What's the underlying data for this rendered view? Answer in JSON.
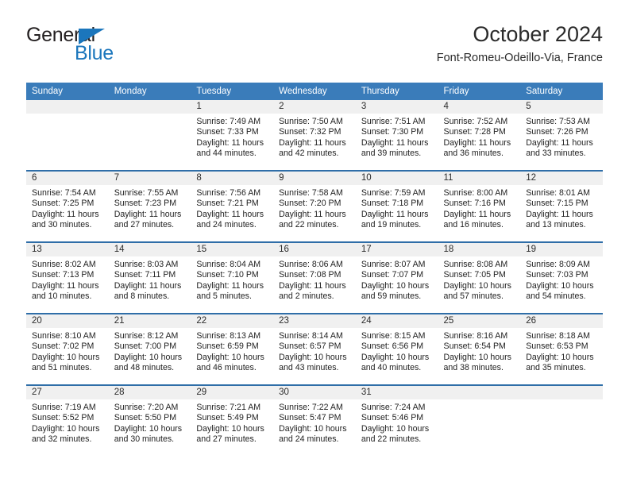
{
  "brand": {
    "name_part1": "General",
    "name_part2": "Blue",
    "triangle_icon": "triangle-icon",
    "colors": {
      "dark": "#231f20",
      "blue": "#1b76bc"
    }
  },
  "header": {
    "title": "October 2024",
    "subtitle": "Font-Romeu-Odeillo-Via, France"
  },
  "theme": {
    "header_bg": "#3a7cba",
    "row_divider": "#2f6ea8",
    "daynum_bg": "#f0f0f0",
    "text": "#222222"
  },
  "calendar": {
    "weekday_headers": [
      "Sunday",
      "Monday",
      "Tuesday",
      "Wednesday",
      "Thursday",
      "Friday",
      "Saturday"
    ],
    "weeks": [
      [
        {
          "day": "",
          "empty": true
        },
        {
          "day": "",
          "empty": true
        },
        {
          "day": "1",
          "sunrise": "Sunrise: 7:49 AM",
          "sunset": "Sunset: 7:33 PM",
          "daylight_l1": "Daylight: 11 hours",
          "daylight_l2": "and 44 minutes."
        },
        {
          "day": "2",
          "sunrise": "Sunrise: 7:50 AM",
          "sunset": "Sunset: 7:32 PM",
          "daylight_l1": "Daylight: 11 hours",
          "daylight_l2": "and 42 minutes."
        },
        {
          "day": "3",
          "sunrise": "Sunrise: 7:51 AM",
          "sunset": "Sunset: 7:30 PM",
          "daylight_l1": "Daylight: 11 hours",
          "daylight_l2": "and 39 minutes."
        },
        {
          "day": "4",
          "sunrise": "Sunrise: 7:52 AM",
          "sunset": "Sunset: 7:28 PM",
          "daylight_l1": "Daylight: 11 hours",
          "daylight_l2": "and 36 minutes."
        },
        {
          "day": "5",
          "sunrise": "Sunrise: 7:53 AM",
          "sunset": "Sunset: 7:26 PM",
          "daylight_l1": "Daylight: 11 hours",
          "daylight_l2": "and 33 minutes."
        }
      ],
      [
        {
          "day": "6",
          "sunrise": "Sunrise: 7:54 AM",
          "sunset": "Sunset: 7:25 PM",
          "daylight_l1": "Daylight: 11 hours",
          "daylight_l2": "and 30 minutes."
        },
        {
          "day": "7",
          "sunrise": "Sunrise: 7:55 AM",
          "sunset": "Sunset: 7:23 PM",
          "daylight_l1": "Daylight: 11 hours",
          "daylight_l2": "and 27 minutes."
        },
        {
          "day": "8",
          "sunrise": "Sunrise: 7:56 AM",
          "sunset": "Sunset: 7:21 PM",
          "daylight_l1": "Daylight: 11 hours",
          "daylight_l2": "and 24 minutes."
        },
        {
          "day": "9",
          "sunrise": "Sunrise: 7:58 AM",
          "sunset": "Sunset: 7:20 PM",
          "daylight_l1": "Daylight: 11 hours",
          "daylight_l2": "and 22 minutes."
        },
        {
          "day": "10",
          "sunrise": "Sunrise: 7:59 AM",
          "sunset": "Sunset: 7:18 PM",
          "daylight_l1": "Daylight: 11 hours",
          "daylight_l2": "and 19 minutes."
        },
        {
          "day": "11",
          "sunrise": "Sunrise: 8:00 AM",
          "sunset": "Sunset: 7:16 PM",
          "daylight_l1": "Daylight: 11 hours",
          "daylight_l2": "and 16 minutes."
        },
        {
          "day": "12",
          "sunrise": "Sunrise: 8:01 AM",
          "sunset": "Sunset: 7:15 PM",
          "daylight_l1": "Daylight: 11 hours",
          "daylight_l2": "and 13 minutes."
        }
      ],
      [
        {
          "day": "13",
          "sunrise": "Sunrise: 8:02 AM",
          "sunset": "Sunset: 7:13 PM",
          "daylight_l1": "Daylight: 11 hours",
          "daylight_l2": "and 10 minutes."
        },
        {
          "day": "14",
          "sunrise": "Sunrise: 8:03 AM",
          "sunset": "Sunset: 7:11 PM",
          "daylight_l1": "Daylight: 11 hours",
          "daylight_l2": "and 8 minutes."
        },
        {
          "day": "15",
          "sunrise": "Sunrise: 8:04 AM",
          "sunset": "Sunset: 7:10 PM",
          "daylight_l1": "Daylight: 11 hours",
          "daylight_l2": "and 5 minutes."
        },
        {
          "day": "16",
          "sunrise": "Sunrise: 8:06 AM",
          "sunset": "Sunset: 7:08 PM",
          "daylight_l1": "Daylight: 11 hours",
          "daylight_l2": "and 2 minutes."
        },
        {
          "day": "17",
          "sunrise": "Sunrise: 8:07 AM",
          "sunset": "Sunset: 7:07 PM",
          "daylight_l1": "Daylight: 10 hours",
          "daylight_l2": "and 59 minutes."
        },
        {
          "day": "18",
          "sunrise": "Sunrise: 8:08 AM",
          "sunset": "Sunset: 7:05 PM",
          "daylight_l1": "Daylight: 10 hours",
          "daylight_l2": "and 57 minutes."
        },
        {
          "day": "19",
          "sunrise": "Sunrise: 8:09 AM",
          "sunset": "Sunset: 7:03 PM",
          "daylight_l1": "Daylight: 10 hours",
          "daylight_l2": "and 54 minutes."
        }
      ],
      [
        {
          "day": "20",
          "sunrise": "Sunrise: 8:10 AM",
          "sunset": "Sunset: 7:02 PM",
          "daylight_l1": "Daylight: 10 hours",
          "daylight_l2": "and 51 minutes."
        },
        {
          "day": "21",
          "sunrise": "Sunrise: 8:12 AM",
          "sunset": "Sunset: 7:00 PM",
          "daylight_l1": "Daylight: 10 hours",
          "daylight_l2": "and 48 minutes."
        },
        {
          "day": "22",
          "sunrise": "Sunrise: 8:13 AM",
          "sunset": "Sunset: 6:59 PM",
          "daylight_l1": "Daylight: 10 hours",
          "daylight_l2": "and 46 minutes."
        },
        {
          "day": "23",
          "sunrise": "Sunrise: 8:14 AM",
          "sunset": "Sunset: 6:57 PM",
          "daylight_l1": "Daylight: 10 hours",
          "daylight_l2": "and 43 minutes."
        },
        {
          "day": "24",
          "sunrise": "Sunrise: 8:15 AM",
          "sunset": "Sunset: 6:56 PM",
          "daylight_l1": "Daylight: 10 hours",
          "daylight_l2": "and 40 minutes."
        },
        {
          "day": "25",
          "sunrise": "Sunrise: 8:16 AM",
          "sunset": "Sunset: 6:54 PM",
          "daylight_l1": "Daylight: 10 hours",
          "daylight_l2": "and 38 minutes."
        },
        {
          "day": "26",
          "sunrise": "Sunrise: 8:18 AM",
          "sunset": "Sunset: 6:53 PM",
          "daylight_l1": "Daylight: 10 hours",
          "daylight_l2": "and 35 minutes."
        }
      ],
      [
        {
          "day": "27",
          "sunrise": "Sunrise: 7:19 AM",
          "sunset": "Sunset: 5:52 PM",
          "daylight_l1": "Daylight: 10 hours",
          "daylight_l2": "and 32 minutes."
        },
        {
          "day": "28",
          "sunrise": "Sunrise: 7:20 AM",
          "sunset": "Sunset: 5:50 PM",
          "daylight_l1": "Daylight: 10 hours",
          "daylight_l2": "and 30 minutes."
        },
        {
          "day": "29",
          "sunrise": "Sunrise: 7:21 AM",
          "sunset": "Sunset: 5:49 PM",
          "daylight_l1": "Daylight: 10 hours",
          "daylight_l2": "and 27 minutes."
        },
        {
          "day": "30",
          "sunrise": "Sunrise: 7:22 AM",
          "sunset": "Sunset: 5:47 PM",
          "daylight_l1": "Daylight: 10 hours",
          "daylight_l2": "and 24 minutes."
        },
        {
          "day": "31",
          "sunrise": "Sunrise: 7:24 AM",
          "sunset": "Sunset: 5:46 PM",
          "daylight_l1": "Daylight: 10 hours",
          "daylight_l2": "and 22 minutes."
        },
        {
          "day": "",
          "empty": true
        },
        {
          "day": "",
          "empty": true
        }
      ]
    ]
  }
}
